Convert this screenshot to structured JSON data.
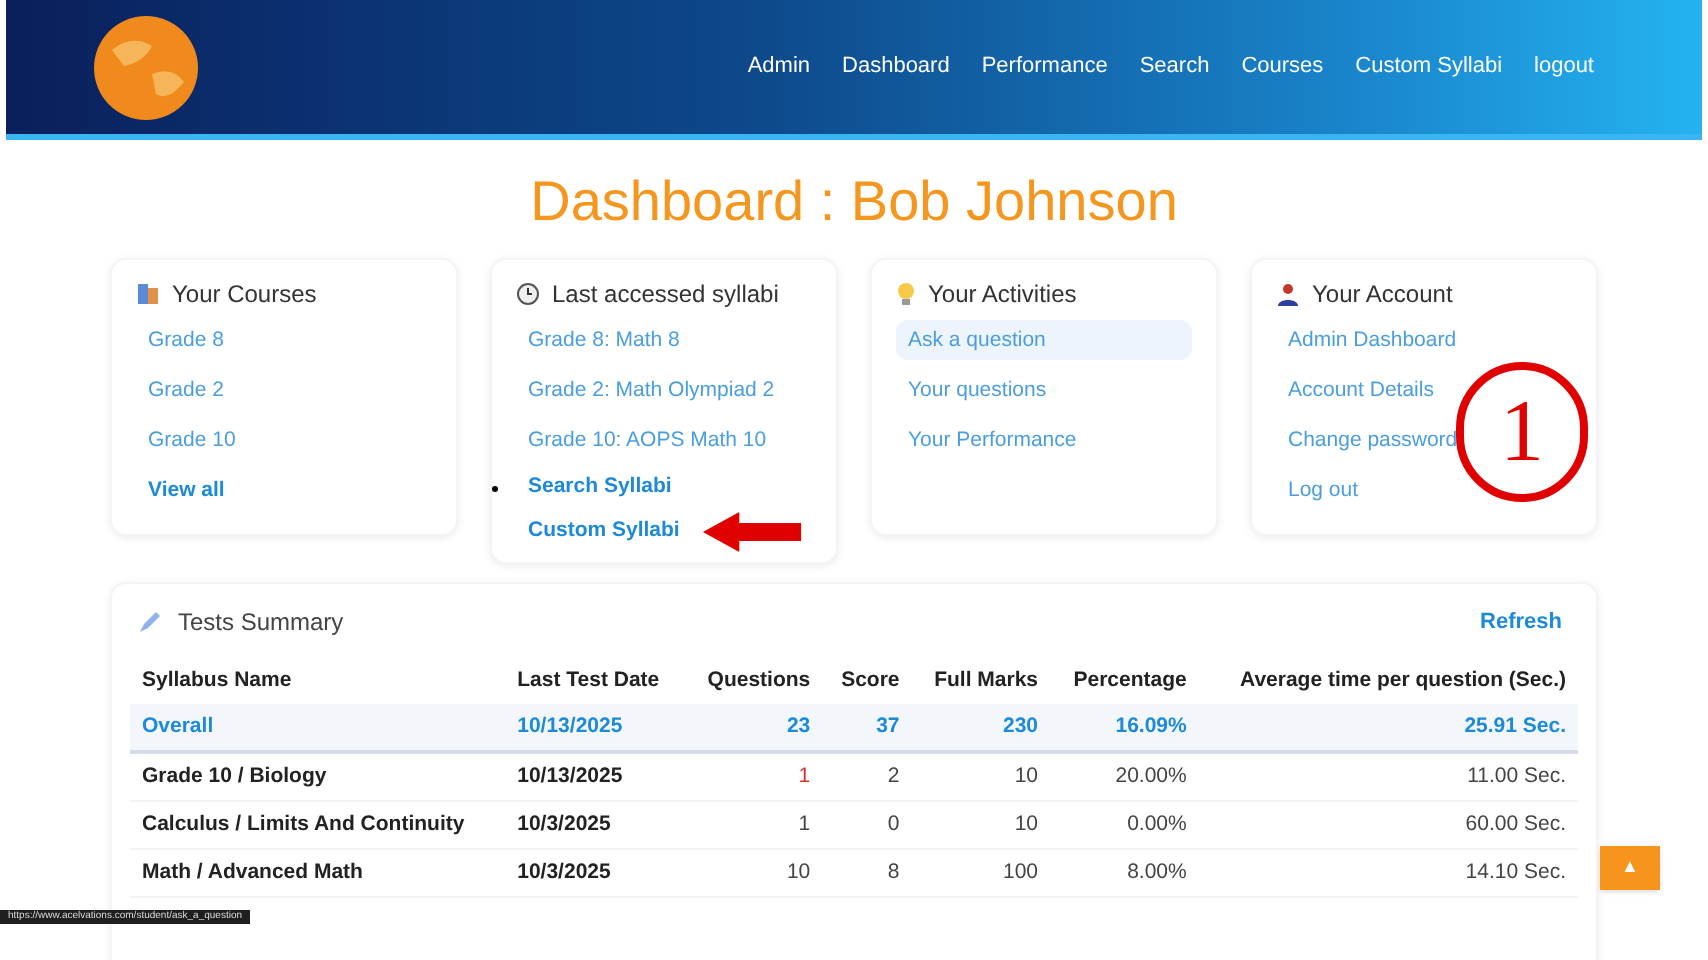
{
  "nav": {
    "items": [
      "Admin",
      "Dashboard",
      "Performance",
      "Search",
      "Courses",
      "Custom Syllabi",
      "logout"
    ]
  },
  "page_title": "Dashboard : Bob Johnson",
  "cards": [
    {
      "kind": "courses",
      "title": "Your Courses",
      "links": [
        {
          "label": "Grade 8",
          "selected": false
        },
        {
          "label": "Grade 2",
          "selected": false
        },
        {
          "label": "Grade 10",
          "selected": false
        }
      ],
      "footer_links": [
        "View all"
      ]
    },
    {
      "kind": "syllabi",
      "title": "Last accessed syllabi",
      "links": [
        {
          "label": "Grade 8: Math 8",
          "selected": false
        },
        {
          "label": "Grade 2: Math Olympiad 2",
          "selected": false
        },
        {
          "label": "Grade 10: AOPS Math 10",
          "selected": false
        }
      ],
      "footer_links": [
        "Search Syllabi",
        "Custom Syllabi"
      ]
    },
    {
      "kind": "activities",
      "title": "Your Activities",
      "links": [
        {
          "label": "Ask a question",
          "selected": true
        },
        {
          "label": "Your questions",
          "selected": false
        },
        {
          "label": "Your Performance",
          "selected": false
        }
      ]
    },
    {
      "kind": "account",
      "title": "Your Account",
      "links": [
        {
          "label": "Admin Dashboard",
          "selected": false
        },
        {
          "label": "Account Details",
          "selected": false
        },
        {
          "label": "Change password",
          "selected": false
        },
        {
          "label": "Log out",
          "selected": false
        }
      ]
    }
  ],
  "tests_summary": {
    "title": "Tests Summary",
    "refresh": "Refresh",
    "columns": [
      "Syllabus Name",
      "Last Test Date",
      "Questions",
      "Score",
      "Full Marks",
      "Percentage",
      "Average time per question (Sec.)"
    ],
    "rows": [
      {
        "kind": "total",
        "cells": [
          "Overall",
          "10/13/2025",
          "23",
          "37",
          "230",
          "16.09%",
          "25.91 Sec."
        ],
        "questions_alert": false
      },
      {
        "kind": "row",
        "cells": [
          "Grade 10 / Biology",
          "10/13/2025",
          "1",
          "2",
          "10",
          "20.00%",
          "11.00 Sec."
        ],
        "questions_alert": true
      },
      {
        "kind": "row",
        "cells": [
          "Calculus / Limits And Continuity",
          "10/3/2025",
          "1",
          "0",
          "10",
          "0.00%",
          "60.00 Sec."
        ],
        "questions_alert": false
      },
      {
        "kind": "row",
        "cells": [
          "Math / Advanced Math",
          "10/3/2025",
          "10",
          "8",
          "100",
          "8.00%",
          "14.10 Sec."
        ],
        "questions_alert": false
      }
    ]
  },
  "annotation": {
    "marker": "1"
  },
  "status_url": "https://www.acelvations.com/student/ask_a_question",
  "scroll_top": "▲"
}
